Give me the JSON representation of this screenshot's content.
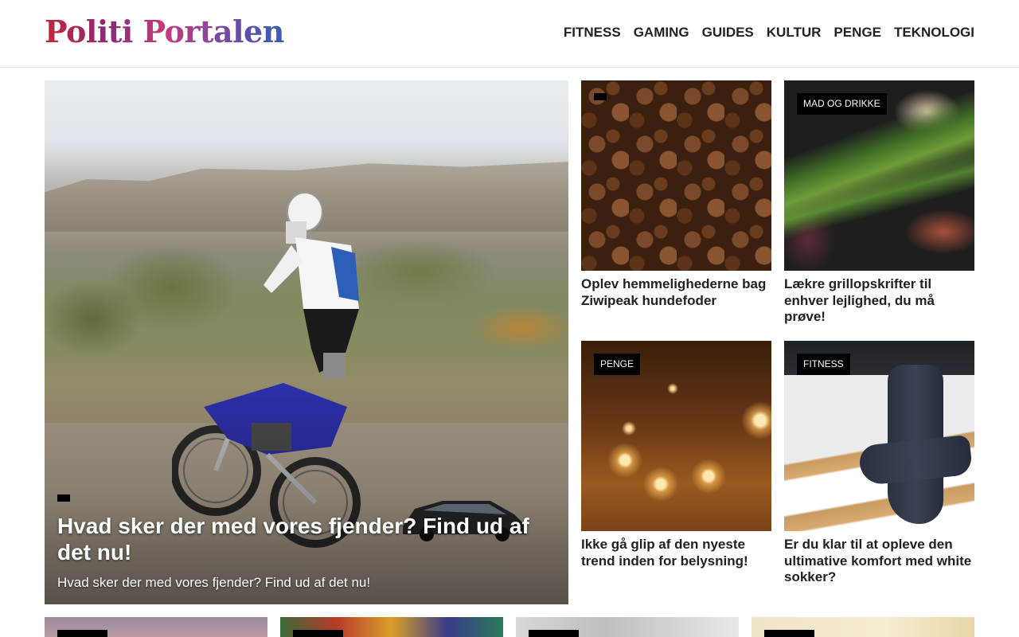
{
  "site": {
    "logo_text": "Politi Portalen"
  },
  "nav": {
    "items": [
      "FITNESS",
      "GAMING",
      "GUIDES",
      "KULTUR",
      "PENGE",
      "TEKNOLOGI"
    ]
  },
  "featured": {
    "category": "",
    "title": "Hvad sker der med vores fjender? Find ud af det nu!",
    "excerpt": "Hvad sker der med vores fjender? Find ud af det nu!"
  },
  "cards": [
    {
      "category": "",
      "title": "Oplev hemmelighederne bag Ziwipeak hundefoder"
    },
    {
      "category": "MAD OG DRIKKE",
      "title": "Lækre grillopskrifter til enhver lejlighed, du må prøve!"
    },
    {
      "category": "PENGE",
      "title": "Ikke gå glip af den nyeste trend inden for belysning!"
    },
    {
      "category": "FITNESS",
      "title": "Er du klar til at opleve den ultimative komfort med white sokker?"
    }
  ],
  "colors": {
    "category_badge_bg": "#000000",
    "category_badge_text": "#ffffff",
    "text_primary": "#222222"
  }
}
